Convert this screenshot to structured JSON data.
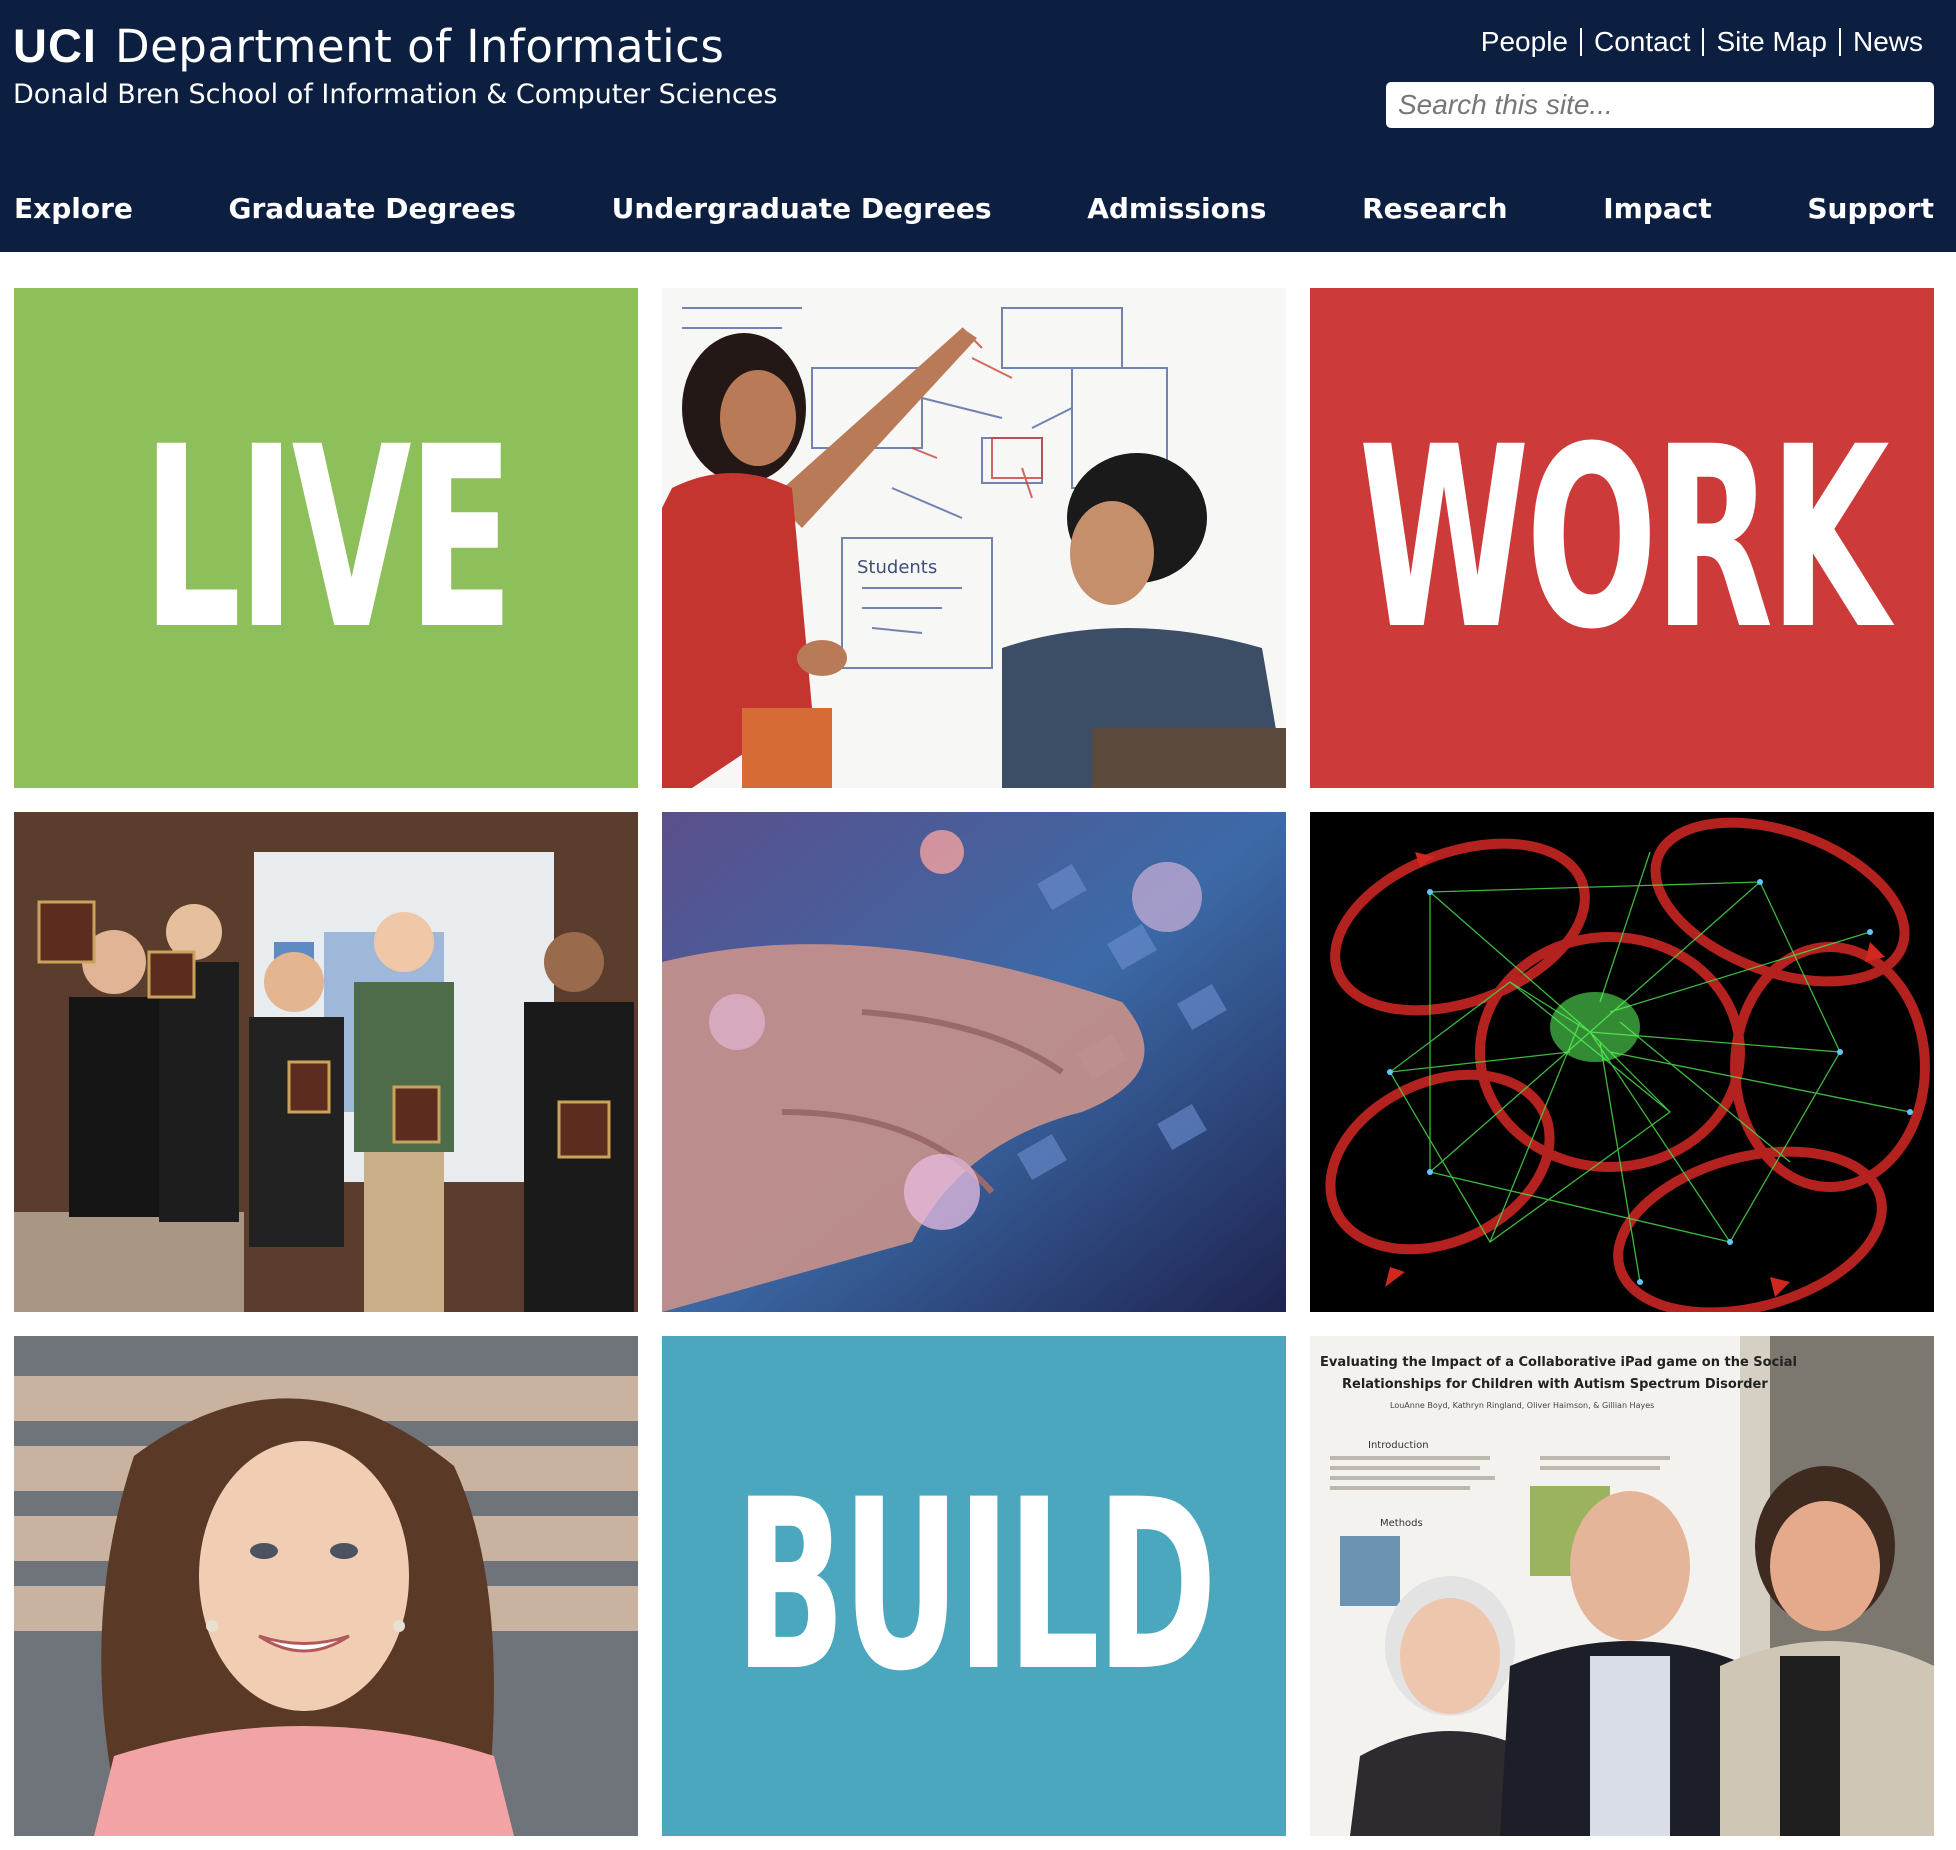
{
  "header": {
    "logo": "UCI",
    "title": "Department of Informatics",
    "subtitle": "Donald Bren School of Information & Computer Sciences",
    "background": "#0c1f41"
  },
  "utility_links": [
    "People",
    "Contact",
    "Site Map",
    "News"
  ],
  "search": {
    "placeholder": "Search this site..."
  },
  "nav": [
    "Explore",
    "Graduate Degrees",
    "Undergraduate Degrees",
    "Admissions",
    "Research",
    "Impact",
    "Support"
  ],
  "tiles": {
    "live": {
      "word": "LIVE",
      "color": "#8dc05a"
    },
    "work": {
      "word": "WORK",
      "color": "#cc3a3a"
    },
    "build": {
      "word": "BUILD",
      "color": "#4aa7bd"
    },
    "poster_title_1": "Evaluating the Impact of a Collaborative iPad game on the Social",
    "poster_title_2": "Relationships for Children with Autism Spectrum Disorder",
    "poster_authors": "LouAnne Boyd, Kathryn Ringland, Oliver Haimson, & Gillian Hayes",
    "poster_intro": "Introduction",
    "poster_methods": "Methods",
    "whiteboard_label": "Students"
  }
}
